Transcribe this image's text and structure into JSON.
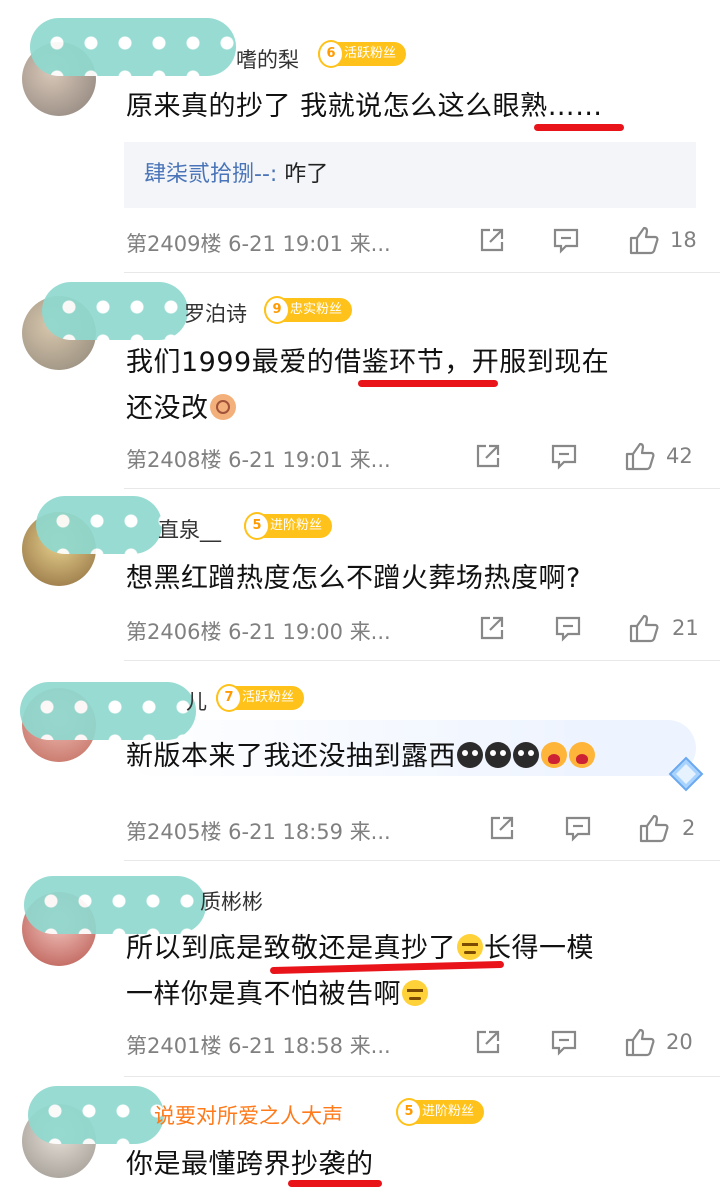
{
  "comments": [
    {
      "user": "嗜的梨",
      "badge_level": "6",
      "badge_label": "活跃粉丝",
      "text": "原来真的抄了 我就说怎么这么眼熟……",
      "reply": {
        "user": "肆柒贰拾捌--:",
        "text": " 咋了"
      },
      "floor": "第2409楼",
      "time": "6-21 19:01",
      "source": "来...",
      "likes": "18"
    },
    {
      "user": "罗泊诗",
      "badge_level": "9",
      "badge_label": "忠实粉丝",
      "text_line1": "我们1999最爱的借鉴环节，开服到现在",
      "text_line2": "还没改",
      "floor": "第2408楼",
      "time": "6-21 19:01",
      "source": "来...",
      "likes": "42"
    },
    {
      "user": "直泉__",
      "badge_level": "5",
      "badge_label": "进阶粉丝",
      "text": "想黑红蹭热度怎么不蹭火葬场热度啊?",
      "floor": "第2406楼",
      "time": "6-21 19:00",
      "source": "来...",
      "likes": "21"
    },
    {
      "user": "儿",
      "badge_level": "7",
      "badge_label": "活跃粉丝",
      "text": "新版本来了我还没抽到露西",
      "floor": "第2405楼",
      "time": "6-21 18:59",
      "source": "来...",
      "likes": "2"
    },
    {
      "user": "质彬彬",
      "text_part1": "所以到底是致敬还是真抄了",
      "text_part2": "长得一模",
      "text_line2": "一样你是真不怕被告啊",
      "floor": "第2401楼",
      "time": "6-21 18:58",
      "source": "来...",
      "likes": "20"
    },
    {
      "user": "说要对所爱之人大声",
      "badge_level": "5",
      "badge_label": "进阶粉丝",
      "text": "你是最懂跨界抄袭的"
    }
  ],
  "icons": [
    "share-icon",
    "comment-icon",
    "like-icon"
  ],
  "colors": {
    "accent_underline": "#e8141a",
    "badge": "#ffc21a",
    "reply_user": "#4a74b8"
  }
}
